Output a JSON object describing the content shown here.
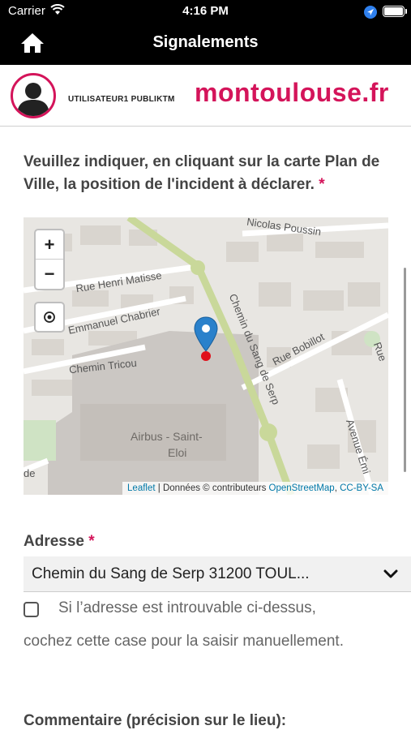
{
  "status_bar": {
    "carrier": "Carrier",
    "time": "4:16 PM"
  },
  "nav": {
    "title": "Signalements",
    "home_icon": "home-icon"
  },
  "brand": {
    "user": "UTILISATEUR1 PUBLIKTM",
    "logo": "montoulouse.fr"
  },
  "form": {
    "map_instruction": "Veuillez indiquer, en cliquant sur la carte Plan de Ville, la position de l'incident à déclarer.",
    "required_mark": "*",
    "map": {
      "zoom_in": "+",
      "zoom_out": "−",
      "streets": [
        "Nicolas Poussin",
        "Rue Henri Matisse",
        "Emmanuel Chabrier",
        "Chemin Tricou",
        "Chemin du Sang de Serp",
        "Rue Bobillot",
        "Airbus - Saint-",
        "Eloi",
        "Avenue Émi",
        "Rue",
        "de"
      ],
      "attribution": {
        "leaflet": "Leaflet",
        "sep": " | Données © contributeurs ",
        "osm": "OpenStreetMap",
        "comma": ", ",
        "license": "CC-BY-SA"
      }
    },
    "address_label": "Adresse",
    "address_value": "Chemin du Sang de Serp 31200 TOUL...",
    "manual_checkbox_line1": "Si l’adresse est introuvable ci-dessus,",
    "manual_checkbox_line2": "cochez cette case pour la saisir manuellement.",
    "comment_label": "Commentaire (précision sur le lieu):"
  },
  "colors": {
    "brand": "#d4145a",
    "link": "#0078a8",
    "marker": "#2a81cb"
  }
}
